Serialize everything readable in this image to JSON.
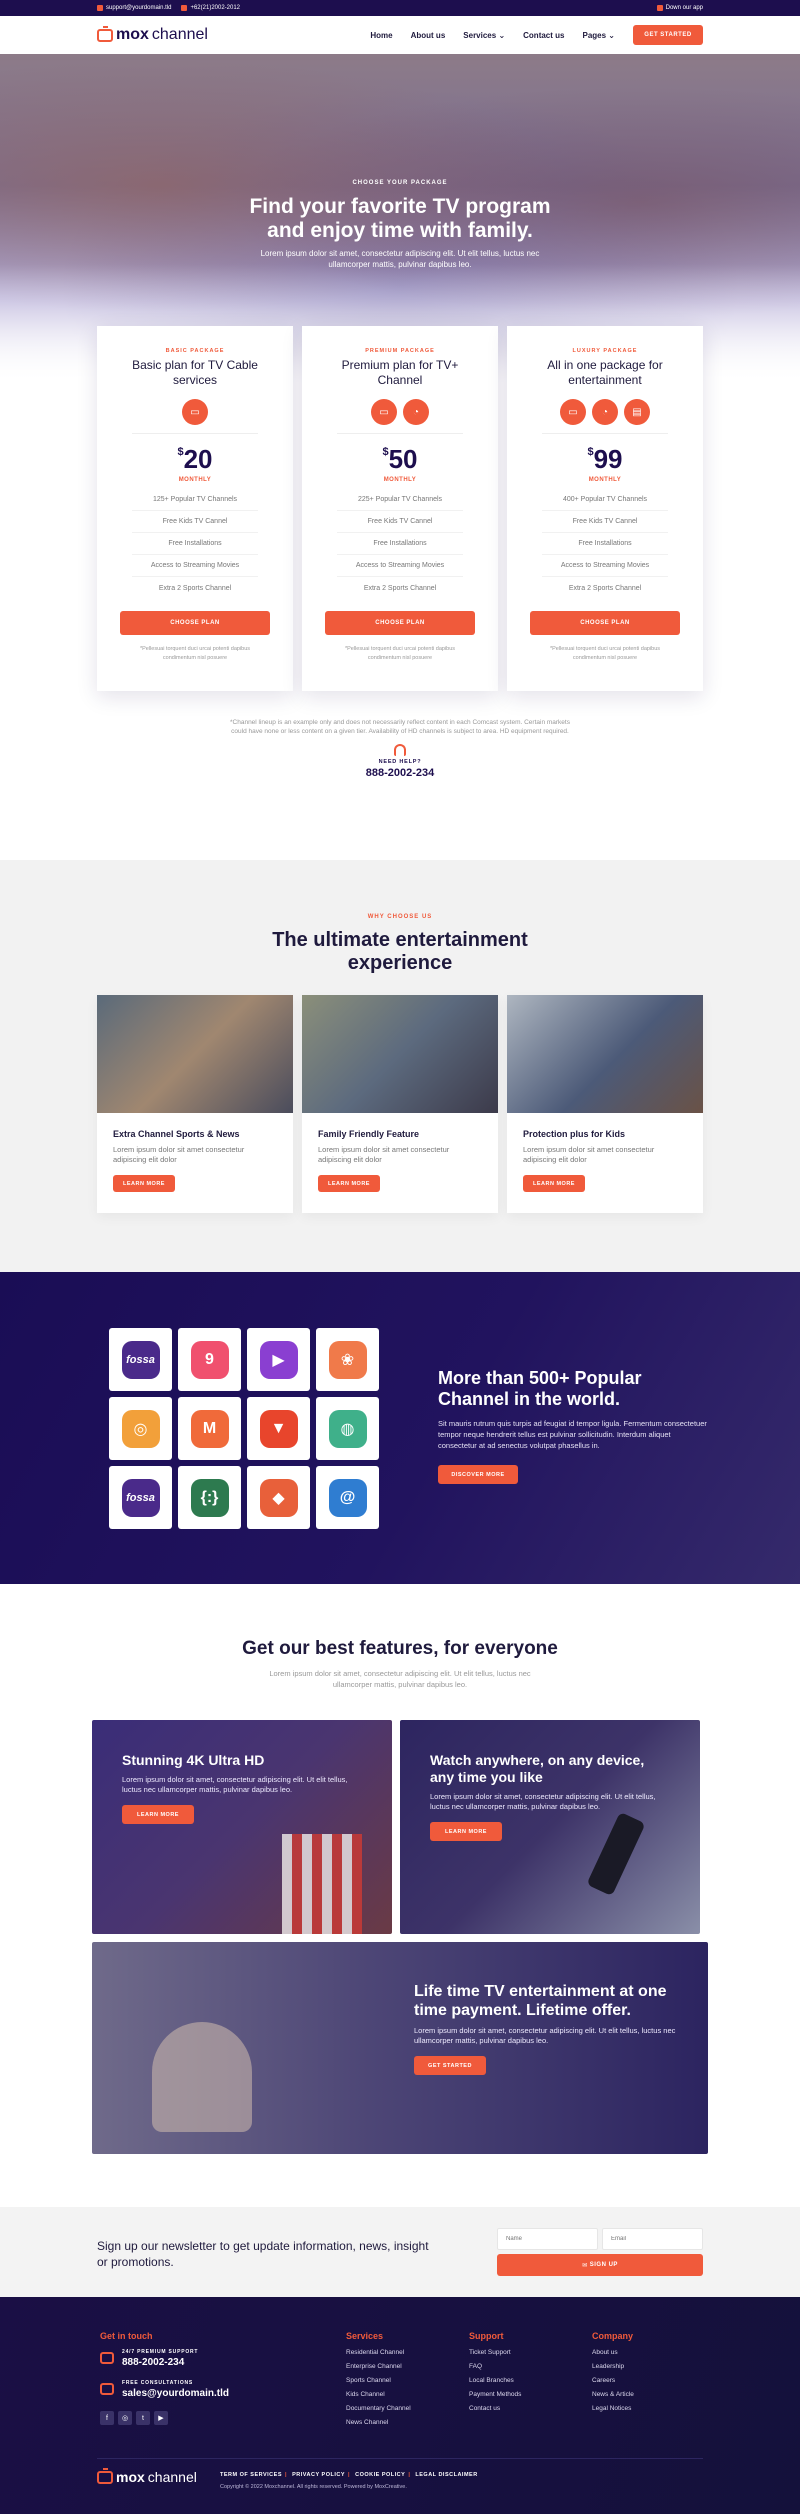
{
  "topbar": {
    "email": "support@yourdomain.tld",
    "phone": "+62(21)2002-2012",
    "download": "Down our app"
  },
  "nav": {
    "logo_bold": "mox",
    "logo_light": "channel",
    "items": [
      "Home",
      "About us",
      "Services",
      "Contact us",
      "Pages"
    ],
    "cta": "GET STARTED"
  },
  "hero": {
    "eyebrow": "CHOOSE YOUR PACKAGE",
    "title": "Find your favorite TV program and enjoy time with family.",
    "text": "Lorem ipsum dolor sit amet, consectetur adipiscing elit. Ut elit tellus, luctus nec ullamcorper mattis, pulvinar dapibus leo."
  },
  "plans": [
    {
      "eyebrow": "BASIC PACKAGE",
      "title": "Basic plan for TV Cable services",
      "price": "20",
      "period": "MONTHLY",
      "features": [
        "125+ Popular TV Channels",
        "Free Kids TV Cannel",
        "Free Installations",
        "Access to Streaming Movies",
        "Extra 2 Sports Channel"
      ],
      "button": "CHOOSE PLAN",
      "note": "*Pellesuai torquent duci urcai potenti dapibus condimentum nisl posuere"
    },
    {
      "eyebrow": "PREMIUM PACKAGE",
      "title": "Premium plan for TV+ Channel",
      "price": "50",
      "period": "MONTHLY",
      "features": [
        "225+ Popular TV Channels",
        "Free Kids TV Cannel",
        "Free Installations",
        "Access to Streaming Movies",
        "Extra 2 Sports Channel"
      ],
      "button": "CHOOSE PLAN",
      "note": "*Pellesuai torquent duci urcai potenti dapibus condimentum nisl posuere"
    },
    {
      "eyebrow": "LUXURY PACKAGE",
      "title": "All in one package for entertainment",
      "price": "99",
      "period": "MONTHLY",
      "features": [
        "400+ Popular TV Channels",
        "Free Kids TV Cannel",
        "Free Installations",
        "Access to Streaming Movies",
        "Extra 2 Sports Channel"
      ],
      "button": "CHOOSE PLAN",
      "note": "*Pellesuai torquent duci urcai potenti dapibus condimentum nisl posuere"
    }
  ],
  "currency": "$",
  "disclaimer": {
    "text": "*Channel lineup is an example only and does not necessarily reflect content in each Comcast system. Certain markets could have none or less content on a given tier. Availability of HD channels is subject to area. HD equipment required.",
    "need_help": "NEED HELP?",
    "phone": "888-2002-234"
  },
  "why": {
    "eyebrow": "WHY CHOOSE US",
    "title": "The ultimate entertainment experience",
    "cards": [
      {
        "title": "Extra Channel Sports & News",
        "text": "Lorem ipsum dolor sit amet consectetur adipiscing elit dolor",
        "button": "LEARN MORE"
      },
      {
        "title": "Family Friendly Feature",
        "text": "Lorem ipsum dolor sit amet consectetur adipiscing elit dolor",
        "button": "LEARN MORE"
      },
      {
        "title": "Protection plus for Kids",
        "text": "Lorem ipsum dolor sit amet consectetur adipiscing elit dolor",
        "button": "LEARN MORE"
      }
    ]
  },
  "channels": {
    "title": "More than 500+ Popular Channel in the world.",
    "text": "Sit mauris rutrum quis turpis ad feugiat id tempor ligula. Fermentum consectetuer tempor neque hendrerit tellus est pulvinar sollicitudin. Interdum aliquet consectetur at ad senectus volutpat phasellus in.",
    "button": "DISCOVER MORE",
    "logos": [
      {
        "name": "fossa-logo",
        "glyph": "fossa",
        "color": "#4a2a8a"
      },
      {
        "name": "pin-logo",
        "glyph": "9",
        "color": "#f0506e"
      },
      {
        "name": "tv-play-logo",
        "glyph": "▶",
        "color": "#8a3fd1"
      },
      {
        "name": "lotus-logo",
        "glyph": "❀",
        "color": "#f07a4a"
      },
      {
        "name": "bars-logo",
        "glyph": "◎",
        "color": "#f2a03a"
      },
      {
        "name": "m-logo",
        "glyph": "M",
        "color": "#f06a3a"
      },
      {
        "name": "fox-logo",
        "glyph": "▼",
        "color": "#e8452c"
      },
      {
        "name": "globe-logo",
        "glyph": "◍",
        "color": "#3fb08a"
      },
      {
        "name": "fossa-logo-2",
        "glyph": "fossa",
        "color": "#4a2a8a"
      },
      {
        "name": "braces-logo",
        "glyph": "{:}",
        "color": "#2d7a4f"
      },
      {
        "name": "person-logo",
        "glyph": "◆",
        "color": "#e8603a"
      },
      {
        "name": "at-logo",
        "glyph": "@",
        "color": "#2f7dd1"
      }
    ]
  },
  "features": {
    "title": "Get our best features, for everyone",
    "text": "Lorem ipsum dolor sit amet, consectetur adipiscing elit. Ut elit tellus, luctus nec ullamcorper mattis, pulvinar dapibus leo.",
    "boxes": [
      {
        "title": "Stunning 4K Ultra HD",
        "text": "Lorem ipsum dolor sit amet, consectetur adipiscing elit. Ut elit tellus, luctus nec ullamcorper mattis, pulvinar dapibus leo.",
        "button": "LEARN MORE"
      },
      {
        "title": "Watch anywhere, on any device, any time you like",
        "text": "Lorem ipsum dolor sit amet, consectetur adipiscing elit. Ut elit tellus, luctus nec ullamcorper mattis, pulvinar dapibus leo.",
        "button": "LEARN MORE"
      },
      {
        "title": "Life time TV entertainment at one time payment. Lifetime offer.",
        "text": "Lorem ipsum dolor sit amet, consectetur adipiscing elit. Ut elit tellus, luctus nec ullamcorper mattis, pulvinar dapibus leo.",
        "button": "GET STARTED"
      }
    ]
  },
  "newsletter": {
    "text": "Sign up our newsletter to get update information, news, insight or promotions.",
    "name_placeholder": "Name",
    "email_placeholder": "Email",
    "button": "SIGN UP"
  },
  "footer": {
    "get_in_touch": "Get in touch",
    "support_label": "24/7 PREMIUM SUPPORT",
    "support_phone": "888-2002-234",
    "consult_label": "FREE CONSULTATIONS",
    "consult_email": "sales@yourdomain.tld",
    "services_title": "Services",
    "services": [
      "Residential Channel",
      "Enterprise Channel",
      "Sports Channel",
      "Kids Channel",
      "Documentary Channel",
      "News Channel"
    ],
    "support_title": "Support",
    "support": [
      "Ticket Support",
      "FAQ",
      "Local Branches",
      "Payment Methods",
      "Contact us"
    ],
    "company_title": "Company",
    "company": [
      "About us",
      "Leadership",
      "Careers",
      "News & Article",
      "Legal Notices"
    ],
    "legal": [
      "TERM OF SERVICES",
      "PRIVACY POLICY",
      "COOKIE POLICY",
      "LEGAL DISCLAIMER"
    ],
    "copyright": "Copyright © 2022 Moxchannel. All rights reserved. Powered by MoxCreative."
  },
  "colors": {
    "accent": "#f05a3b",
    "navy": "#1d0e4e"
  }
}
